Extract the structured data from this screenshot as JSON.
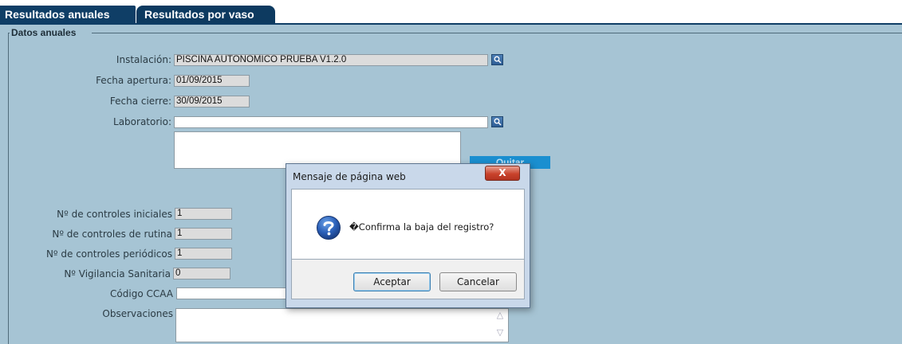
{
  "tabs": [
    {
      "label": "Resultados anuales"
    },
    {
      "label": "Resultados por vaso"
    }
  ],
  "fieldset": {
    "legend": "Datos anuales"
  },
  "form": {
    "instalacion": {
      "label": "Instalación:",
      "value": "PISCINA AUTONOMICO PRUEBA V1.2.0"
    },
    "fecha_apertura": {
      "label": "Fecha apertura:",
      "value": "01/09/2015"
    },
    "fecha_cierre": {
      "label": "Fecha cierre:",
      "value": "30/09/2015"
    },
    "laboratorio": {
      "label": "Laboratorio:",
      "value": ""
    },
    "quitar_label": "Quitar",
    "controles_iniciales": {
      "label": "Nº de controles iniciales",
      "value": "1"
    },
    "controles_rutina": {
      "label": "Nº de controles de rutina",
      "value": "1"
    },
    "controles_periodicos": {
      "label": "Nº de controles periódicos",
      "value": "1"
    },
    "vigilancia_sanitaria": {
      "label": "Nº Vigilancia Sanitaria",
      "value": "0"
    },
    "codigo_ccaa": {
      "label": "Código CCAA",
      "value": ""
    },
    "observaciones": {
      "label": "Observaciones",
      "value": ""
    }
  },
  "dialog": {
    "title": "Mensaje de página web",
    "close_label": "X",
    "message": "�Confirma la baja del registro?",
    "icon": "question-icon",
    "ok_label": "Aceptar",
    "cancel_label": "Cancelar"
  },
  "colors": {
    "tab_bg": "#0f3e66",
    "panel_bg": "#a6c4d4",
    "quitar_bg": "#1a8fd0"
  }
}
